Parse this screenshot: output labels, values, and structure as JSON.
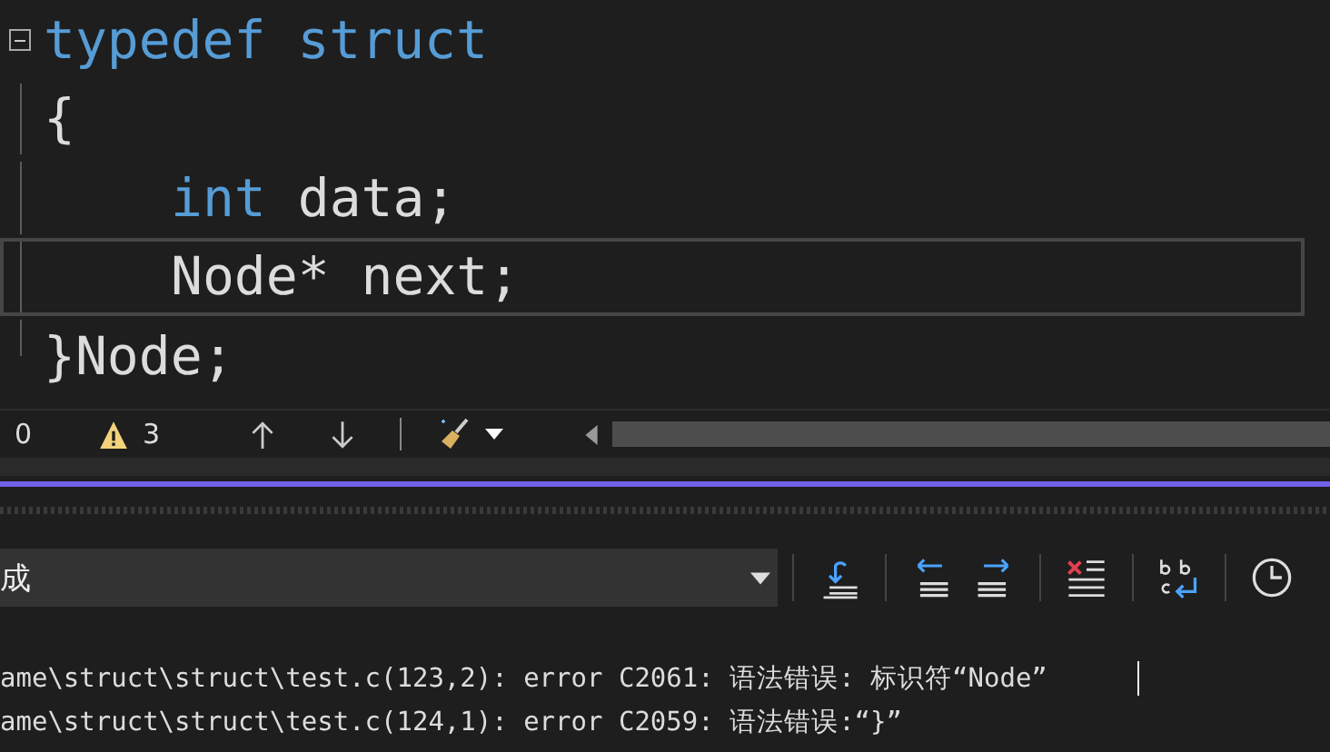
{
  "editor": {
    "lines": [
      {
        "kind": "header",
        "tokens": [
          {
            "text": "typedef",
            "keyword": true
          },
          {
            "text": "struct",
            "keyword": true
          }
        ],
        "current": false
      },
      {
        "kind": "body",
        "tokens": [
          {
            "text": "{",
            "keyword": false
          }
        ],
        "current": false,
        "children": [
          {
            "kind": "body",
            "tokens": [
              {
                "text": "int",
                "keyword": true
              },
              {
                "text": "data;",
                "keyword": false
              }
            ],
            "current": false
          },
          {
            "kind": "body",
            "tokens": [
              {
                "text": "Node*",
                "keyword": false
              },
              {
                "text": "next;",
                "keyword": false
              }
            ],
            "current": true
          }
        ]
      },
      {
        "kind": "end",
        "tokens": [
          {
            "text": "}Node;",
            "keyword": false
          }
        ],
        "current": false
      }
    ]
  },
  "status_bar": {
    "errors": "0",
    "warnings": "3"
  },
  "output": {
    "source": "成",
    "lines": [
      "ame\\struct\\struct\\test.c(123,2): error C2061: 语法错误: 标识符“Node”",
      "ame\\struct\\struct\\test.c(124,1): error C2059: 语法错误:“}”"
    ]
  }
}
